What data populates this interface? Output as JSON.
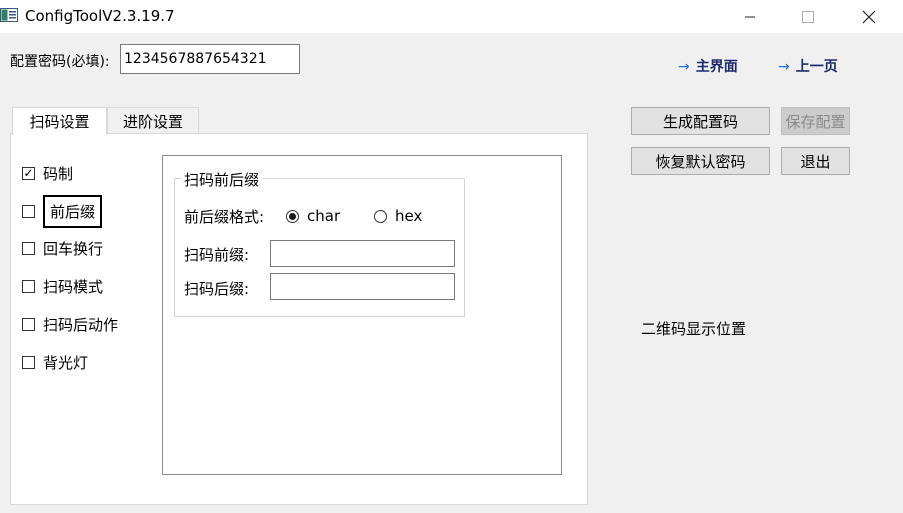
{
  "window": {
    "title": "ConfigToolV2.3.19.7",
    "controls": {
      "minimize": "—",
      "maximize": "☐",
      "close": "✕"
    }
  },
  "password": {
    "label": "配置密码(必填):",
    "value": "1234567887654321"
  },
  "nav": {
    "home": "主界面",
    "prev": "上一页",
    "arrow": "→"
  },
  "tabs": [
    {
      "label": "扫码设置",
      "selected": true
    },
    {
      "label": "进阶设置",
      "selected": false
    }
  ],
  "sidebar": {
    "items": [
      {
        "label": "码制",
        "checked": true
      },
      {
        "label": "前后缀",
        "checked": false,
        "focused": true
      },
      {
        "label": "回车换行",
        "checked": false
      },
      {
        "label": "扫码模式",
        "checked": false
      },
      {
        "label": "扫码后动作",
        "checked": false
      },
      {
        "label": "背光灯",
        "checked": false
      }
    ]
  },
  "affix": {
    "group_title": "扫码前后缀",
    "format_label": "前后缀格式:",
    "format_options": [
      {
        "label": "char",
        "selected": true
      },
      {
        "label": "hex",
        "selected": false
      }
    ],
    "prefix_label": "扫码前缀:",
    "prefix_value": "",
    "suffix_label": "扫码后缀:",
    "suffix_value": ""
  },
  "buttons": {
    "generate": "生成配置码",
    "save": "保存配置",
    "restore": "恢复默认密码",
    "exit": "退出"
  },
  "qr_placeholder": "二维码显示位置",
  "colors": {
    "nav_text": "#1a2a6c",
    "nav_arrow": "#1f6fd6",
    "window_bg": "#f0f0f0"
  }
}
